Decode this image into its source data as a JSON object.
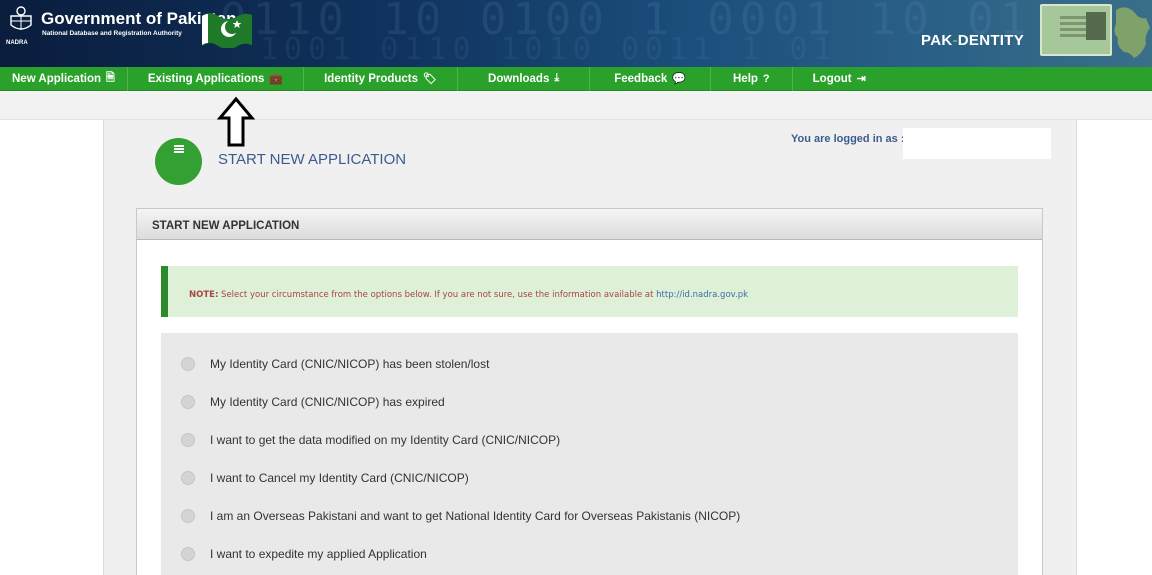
{
  "header": {
    "title": "Government of Pakistan",
    "subtitle": "National Database and Registration Authority",
    "emblem_tag": "NADRA",
    "brand_left": "PAK",
    "brand_slash": "-",
    "brand_right": "DENTITY"
  },
  "nav": {
    "items": [
      {
        "label": "New Application",
        "icon": "document-icon",
        "glyph": "🗎"
      },
      {
        "label": "Existing Applications",
        "icon": "briefcase-icon",
        "glyph": "💼"
      },
      {
        "label": "Identity Products",
        "icon": "tag-icon",
        "glyph": "🏷"
      },
      {
        "label": "Downloads",
        "icon": "download-icon",
        "glyph": "⤓"
      },
      {
        "label": "Feedback",
        "icon": "speech-bubble-icon",
        "glyph": "💬"
      },
      {
        "label": "Help",
        "icon": "question-circle-icon",
        "glyph": "?"
      },
      {
        "label": "Logout",
        "icon": "sign-out-icon",
        "glyph": "⇥"
      }
    ]
  },
  "page": {
    "title": "START NEW APPLICATION",
    "logged_in_label": "You are logged in as :",
    "logged_in_value": ""
  },
  "panel": {
    "heading": "START NEW APPLICATION",
    "note_label": "NOTE:",
    "note_text": " Select your circumstance from the options below. If you are not sure, use the information available at ",
    "note_link": "http://id.nadra.gov.pk"
  },
  "options": [
    "My Identity Card (CNIC/NICOP) has been stolen/lost",
    "My Identity Card (CNIC/NICOP) has expired",
    "I want to get the data modified on my Identity Card (CNIC/NICOP)",
    "I want to Cancel my Identity Card (CNIC/NICOP)",
    "I am an Overseas Pakistani and want to get National Identity Card for Overseas Pakistanis (NICOP)",
    "I want to expedite my applied Application"
  ],
  "colors": {
    "nav_green": "#29a12a",
    "title_blue": "#3c5c8c",
    "note_bg": "#dff0d8",
    "note_text": "#a94442"
  }
}
